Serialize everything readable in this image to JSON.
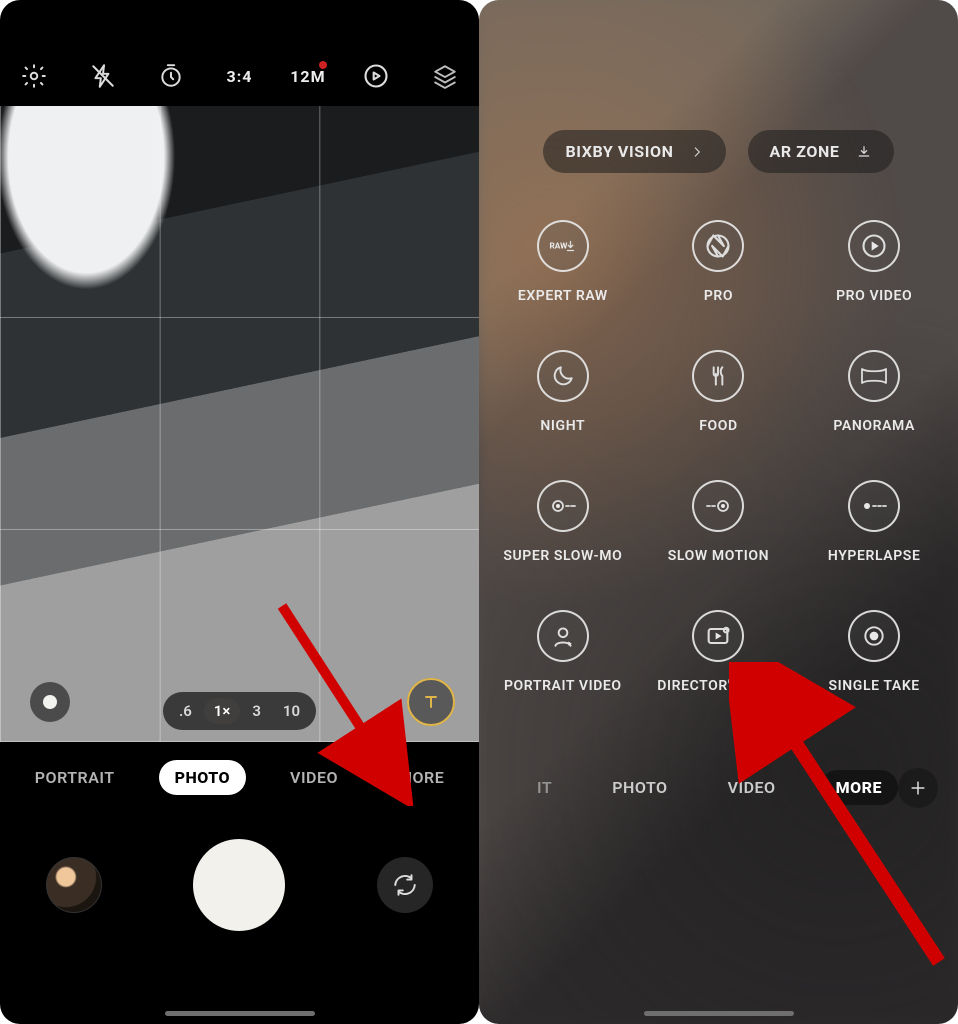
{
  "left": {
    "top_icons": [
      "settings",
      "flash-off",
      "timer",
      "aspect",
      "resolution",
      "motion-photo",
      "filters"
    ],
    "aspect_label": "3:4",
    "resolution_label": "12M",
    "zoom": {
      "options": [
        ".6",
        "1×",
        "3",
        "10"
      ],
      "active_index": 1
    },
    "modes": {
      "items": [
        "PORTRAIT",
        "PHOTO",
        "VIDEO",
        "MORE"
      ],
      "selected_index": 1
    }
  },
  "right": {
    "pills": [
      {
        "label": "BIXBY VISION",
        "icon": "chevron-right"
      },
      {
        "label": "AR ZONE",
        "icon": "download"
      }
    ],
    "grid": [
      {
        "label": "EXPERT RAW",
        "icon": "raw"
      },
      {
        "label": "PRO",
        "icon": "aperture"
      },
      {
        "label": "PRO VIDEO",
        "icon": "play-circle"
      },
      {
        "label": "NIGHT",
        "icon": "moon"
      },
      {
        "label": "FOOD",
        "icon": "food"
      },
      {
        "label": "PANORAMA",
        "icon": "panorama"
      },
      {
        "label": "SUPER SLOW-MO",
        "icon": "slowmo"
      },
      {
        "label": "SLOW MOTION",
        "icon": "slowmotion"
      },
      {
        "label": "HYPERLAPSE",
        "icon": "hyperlapse"
      },
      {
        "label": "PORTRAIT VIDEO",
        "icon": "portrait-video"
      },
      {
        "label": "DIRECTOR'S VIEW",
        "icon": "director"
      },
      {
        "label": "SINGLE TAKE",
        "icon": "single-take"
      }
    ],
    "modes": {
      "items": [
        "IT",
        "PHOTO",
        "VIDEO",
        "MORE"
      ],
      "selected_index": 3
    }
  }
}
